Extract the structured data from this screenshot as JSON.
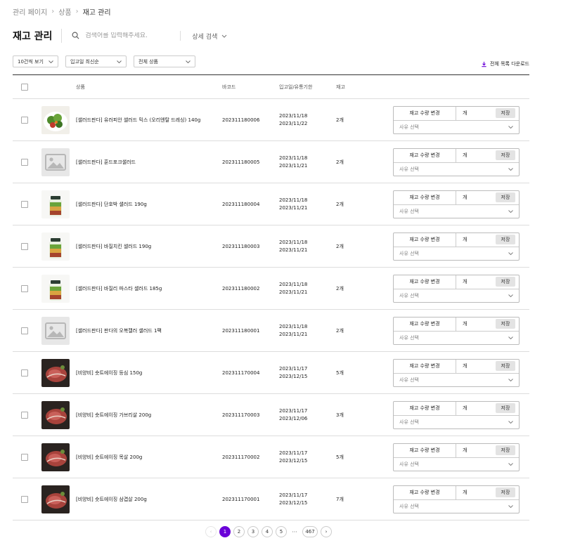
{
  "breadcrumb": [
    "관리 페이지",
    "상품",
    "재고 관리"
  ],
  "title": "재고 관리",
  "search": {
    "placeholder": "검색어를 입력해주세요."
  },
  "detail_search": "상세 검색",
  "filters": {
    "view": "10건씩 보기",
    "sort": "입고일 최신순",
    "category": "전체 상품"
  },
  "download": "전체 목록 다운로드",
  "columns": {
    "product": "상품",
    "barcode": "바코드",
    "dates": "입고일/유통기한",
    "stock": "재고"
  },
  "controls": {
    "stock_change": "재고 수량 변경",
    "unit": "개",
    "save": "저장",
    "reason_placeholder": "사유 선택"
  },
  "rows": [
    {
      "name": "[샐러드판다] 유러피안 샐러드 믹스 (오리엔탈 드레싱) 140g",
      "barcode": "202311180006",
      "in_date": "2023/11/18",
      "exp_date": "2023/11/22",
      "stock": "2개",
      "image": "salad-bowl"
    },
    {
      "name": "[샐러드판다] 훈드포크샐러드",
      "barcode": "202311180005",
      "in_date": "2023/11/18",
      "exp_date": "2023/11/21",
      "stock": "2개",
      "image": "placeholder"
    },
    {
      "name": "[샐러드판다] 단호박 샐러드 190g",
      "barcode": "202311180004",
      "in_date": "2023/11/18",
      "exp_date": "2023/11/21",
      "stock": "2개",
      "image": "salad-jar"
    },
    {
      "name": "[샐러드판다] 바질치킨 샐러드 190g",
      "barcode": "202311180003",
      "in_date": "2023/11/18",
      "exp_date": "2023/11/21",
      "stock": "2개",
      "image": "salad-jar"
    },
    {
      "name": "[샐러드판다] 바질리 파스타 샐러드 185g",
      "barcode": "202311180002",
      "in_date": "2023/11/18",
      "exp_date": "2023/11/21",
      "stock": "2개",
      "image": "salad-jar"
    },
    {
      "name": "[샐러드판다] 판다의 오복캘러 샐러드 1팩",
      "barcode": "202311180001",
      "in_date": "2023/11/18",
      "exp_date": "2023/11/21",
      "stock": "2개",
      "image": "placeholder"
    },
    {
      "name": "[비양비] 숏트에이징 등심 150g",
      "barcode": "202311170004",
      "in_date": "2023/11/17",
      "exp_date": "2023/12/15",
      "stock": "5개",
      "image": "steak"
    },
    {
      "name": "[비양비] 숏트에이징 가브리살 200g",
      "barcode": "202311170003",
      "in_date": "2023/11/17",
      "exp_date": "2023/12/06",
      "stock": "3개",
      "image": "steak"
    },
    {
      "name": "[비양비] 숏트에이징 목살 200g",
      "barcode": "202311170002",
      "in_date": "2023/11/17",
      "exp_date": "2023/12/15",
      "stock": "5개",
      "image": "steak"
    },
    {
      "name": "[비양비] 숏트에이징 삼겹살 200g",
      "barcode": "202311170001",
      "in_date": "2023/11/17",
      "exp_date": "2023/12/15",
      "stock": "7개",
      "image": "steak"
    }
  ],
  "pagination": {
    "pages": [
      "1",
      "2",
      "3",
      "4",
      "5"
    ],
    "ellipsis": "···",
    "last": "467",
    "current": "1"
  },
  "colors": {
    "accent": "#6a00d8"
  }
}
